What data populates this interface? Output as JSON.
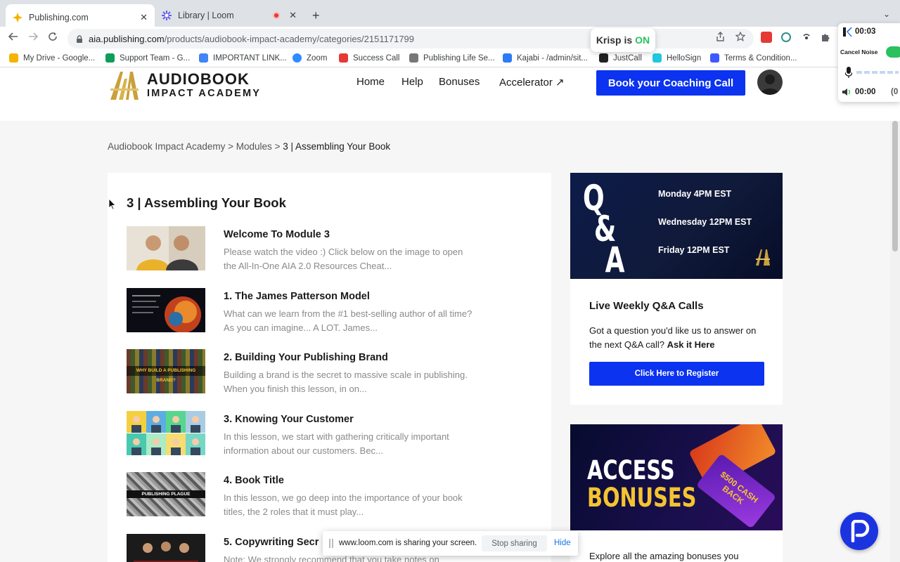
{
  "browser": {
    "tabs": [
      {
        "title": "Publishing.com",
        "active": true
      },
      {
        "title": "Library | Loom",
        "active": false,
        "recording": true
      }
    ],
    "close_glyph": "✕",
    "new_tab_glyph": "+",
    "tab_menu_glyph": "⌄",
    "address": {
      "host": "aia.publishing.com",
      "path": "/products/audiobook-impact-academy/categories/2151171799"
    },
    "bookmarks": [
      {
        "label": "My Drive - Google...",
        "icon": "drive-icon",
        "color": "#f4b400"
      },
      {
        "label": "Support Team - G...",
        "icon": "sheets-icon",
        "color": "#0f9d58"
      },
      {
        "label": "IMPORTANT LINK...",
        "icon": "docs-icon",
        "color": "#4285f4"
      },
      {
        "label": "Zoom",
        "icon": "zoom-icon",
        "color": "#2d8cff"
      },
      {
        "label": "Success Call",
        "icon": "calendar-icon",
        "color": "#e53935"
      },
      {
        "label": "Publishing Life Se...",
        "icon": "site-icon",
        "color": "#777777"
      },
      {
        "label": "Kajabi - /admin/sit...",
        "icon": "kajabi-icon",
        "color": "#2e7bf6"
      },
      {
        "label": "JustCall",
        "icon": "justcall-icon",
        "color": "#222222"
      },
      {
        "label": "HelloSign",
        "icon": "hellosign-icon",
        "color": "#20c7e0"
      },
      {
        "label": "Terms & Condition...",
        "icon": "termly-icon",
        "color": "#3d5afe"
      }
    ]
  },
  "krisp": {
    "pill_prefix": "Krisp is",
    "pill_state": "ON",
    "timer": "00:03",
    "cancel_noise_label": "Cancel Noise",
    "speaker_timer": "00:00",
    "overflow_text": "(0"
  },
  "header": {
    "logo_line1": "AUDIOBOOK",
    "logo_line2": "IMPACT ACADEMY",
    "nav": [
      "Home",
      "Help",
      "Bonuses",
      "Accelerator ↗"
    ],
    "cta_label": "Book your Coaching Call"
  },
  "breadcrumb": {
    "items": [
      "Audiobook Impact Academy",
      "Modules",
      "3 | Assembling Your Book"
    ],
    "separator": ">"
  },
  "module": {
    "title": "3 | Assembling Your Book",
    "lessons": [
      {
        "title": "Welcome To Module 3",
        "desc": "Please watch the video :) Click below on the image to open the All-In-One AIA 2.0 Resources Cheat..."
      },
      {
        "title": "1. The James Patterson Model",
        "desc": "What can we learn from the #1 best-selling author of all time? As you can imagine... A LOT. James..."
      },
      {
        "title": "2. Building Your Publishing Brand",
        "desc": "Building a brand is the secret to massive scale in publishing. When you finish this lesson, in on..."
      },
      {
        "title": "3. Knowing Your Customer",
        "desc": "In this lesson, we start with gathering critically important information about our customers. Bec..."
      },
      {
        "title": "4. Book Title",
        "desc": "In this lesson, we go deep into the importance of your book titles, the 2 roles that it must play..."
      },
      {
        "title": "5. Copywriting Secr",
        "desc": "Note: We strongly recommend that you take notes on"
      }
    ],
    "thumb_captions": {
      "brand": "WHY BUILD A PUBLISHING BRAND?",
      "plague": "PUBLISHING PLAGUE"
    }
  },
  "qa": {
    "letters": [
      "Q",
      "&",
      "A"
    ],
    "times": [
      "Monday 4PM EST",
      "Wednesday 12PM EST",
      "Friday 12PM EST"
    ],
    "title": "Live Weekly Q&A Calls",
    "text": "Got a question you'd like us to answer on the next Q&A call?",
    "link": "Ask it Here",
    "button": "Click Here to Register"
  },
  "bonuses": {
    "word1": "ACCESS",
    "word2": "BONUSES",
    "desc": "Explore all the amazing bonuses you",
    "card_text": "$500 CASH BACK"
  },
  "share_bar": {
    "message": "www.loom.com is sharing your screen.",
    "stop_label": "Stop sharing",
    "hide_label": "Hide"
  },
  "colors": {
    "accent_blue": "#0b33f0",
    "krisp_green": "#2ac15e",
    "bonus_gold": "#f4c430"
  }
}
